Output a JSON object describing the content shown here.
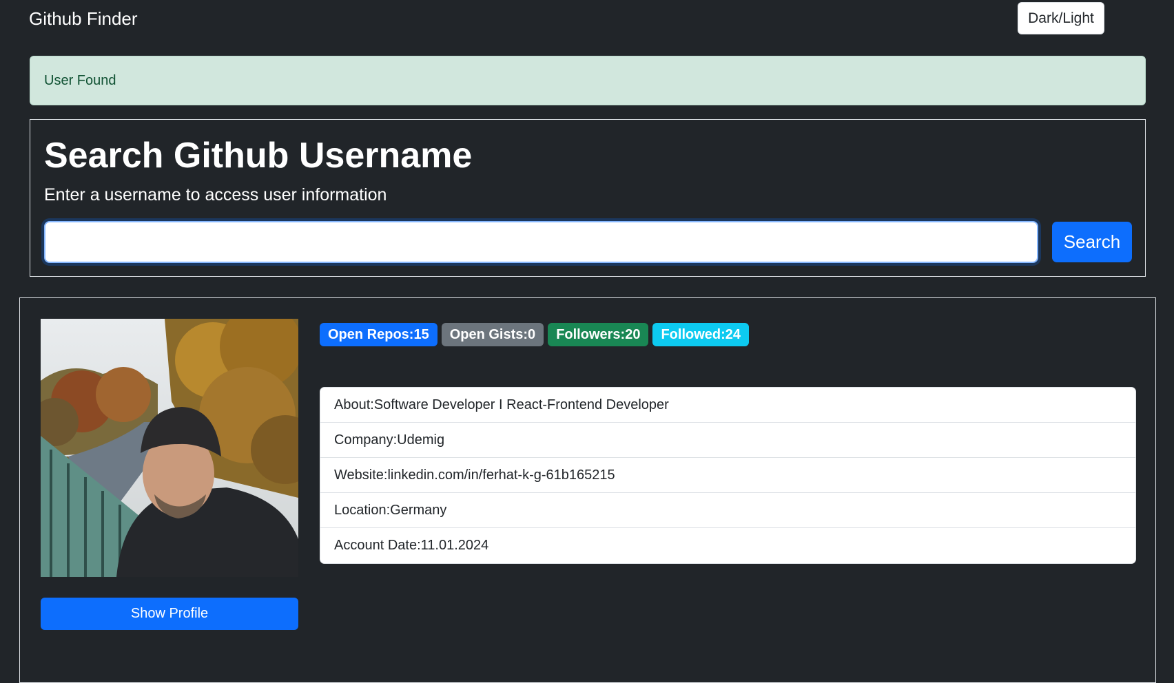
{
  "navbar": {
    "brand": "Github Finder",
    "theme_toggle_label": "Dark/Light"
  },
  "alert": {
    "message": "User Found",
    "type": "success"
  },
  "search": {
    "title": "Search Github Username",
    "subtitle": "Enter a username to access user information",
    "input_value": "",
    "input_placeholder": "",
    "button_label": "Search"
  },
  "profile": {
    "avatar_icon": "user-photo",
    "show_profile_label": "Show Profile",
    "badges": [
      {
        "label": "Open Repos:15",
        "color": "#0d6efd"
      },
      {
        "label": "Open Gists:0",
        "color": "#6c757d"
      },
      {
        "label": "Followers:20",
        "color": "#198754"
      },
      {
        "label": "Followed:24",
        "color": "#0dcaf0"
      }
    ],
    "details": [
      {
        "text": "About:Software Developer I React-Frontend Developer"
      },
      {
        "text": "Company:Udemig"
      },
      {
        "text": "Website:linkedin.com/in/ferhat-k-g-61b165215"
      },
      {
        "text": "Location:Germany"
      },
      {
        "text": "Account Date:11.01.2024"
      }
    ]
  },
  "colors": {
    "background": "#212529",
    "accent": "#0d6efd",
    "alert_bg": "#d1e7dd",
    "alert_text": "#0f5132"
  }
}
